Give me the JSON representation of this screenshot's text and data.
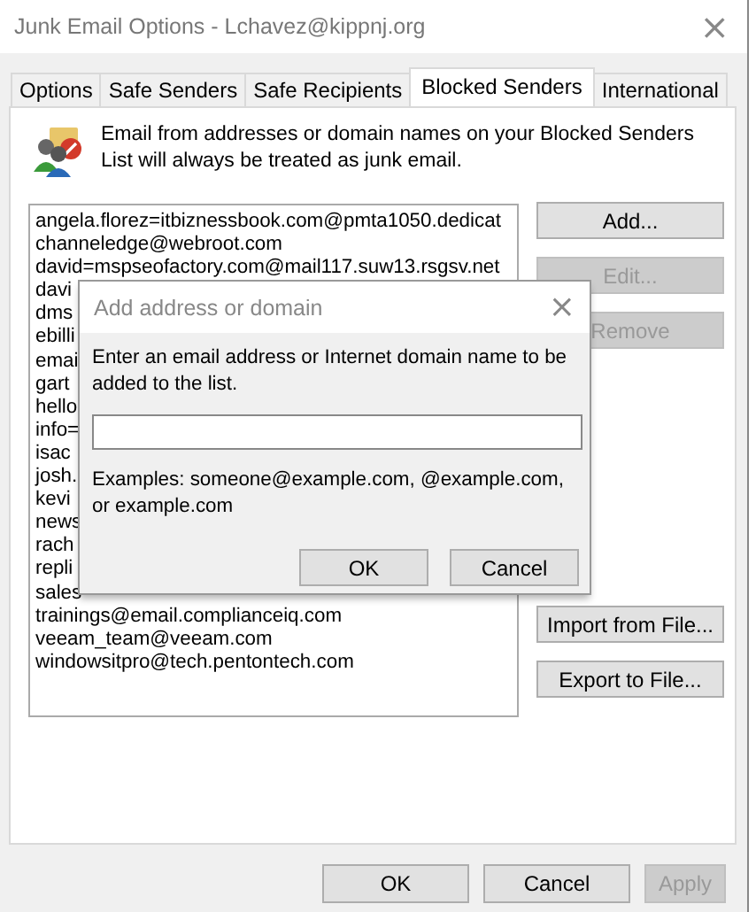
{
  "window": {
    "title": "Junk Email Options - Lchavez@kippnj.org",
    "close": "×"
  },
  "tabs": [
    {
      "label": "Options",
      "selected": false
    },
    {
      "label": "Safe Senders",
      "selected": false
    },
    {
      "label": "Safe Recipients",
      "selected": false
    },
    {
      "label": "Blocked Senders",
      "selected": true
    },
    {
      "label": "International",
      "selected": false
    }
  ],
  "description": "Email from addresses or domain names on your Blocked Senders List will always be treated as junk email.",
  "senders": [
    "angela.florez=itbiznessbook.com@pmta1050.dedicat",
    "channeledge@webroot.com",
    "david=mspseofactory.com@mail117.suw13.rsgsv.net",
    "davi",
    "dms",
    "ebilli",
    "emai",
    "gart",
    "hello",
    "info=",
    "isac",
    "josh.",
    "kevi",
    "news",
    "rach",
    "repli",
    "sales",
    "trainings@email.complianceiq.com",
    "veeam_team@veeam.com",
    "windowsitpro@tech.pentontech.com"
  ],
  "side_buttons": [
    {
      "label": "Add...",
      "disabled": false
    },
    {
      "label": "Edit...",
      "disabled": true
    },
    {
      "label": "Remove",
      "disabled": true
    }
  ],
  "file_buttons": [
    {
      "label": "Import from File...",
      "disabled": false
    },
    {
      "label": "Export to File...",
      "disabled": false
    }
  ],
  "dialog": {
    "title": "Add address or domain",
    "close": "×",
    "prompt": "Enter an email address or Internet domain name to be added to the list.",
    "examples": "Examples: someone@example.com, @example.com, or example.com",
    "buttons": [
      {
        "label": "OK",
        "disabled": false
      },
      {
        "label": "Cancel",
        "disabled": false
      }
    ]
  },
  "footer_buttons": [
    {
      "label": "OK",
      "disabled": false
    },
    {
      "label": "Cancel",
      "disabled": false
    },
    {
      "label": "Apply",
      "disabled": true
    }
  ]
}
